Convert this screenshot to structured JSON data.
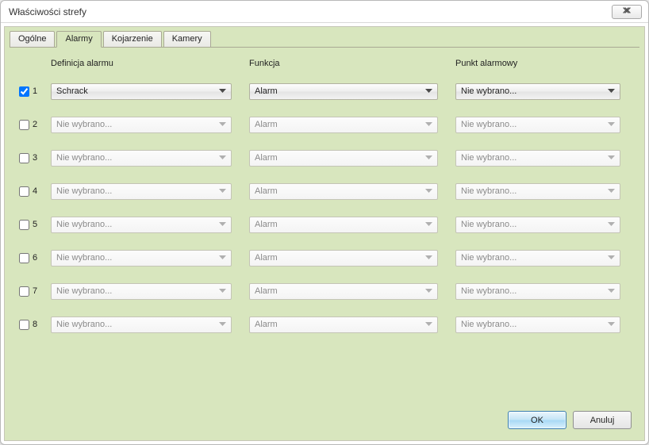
{
  "window": {
    "title": "Właściwości strefy"
  },
  "tabs": {
    "items": [
      "Ogólne",
      "Alarmy",
      "Kojarzenie",
      "Kamery"
    ],
    "active_index": 1
  },
  "headers": {
    "definition": "Definicja alarmu",
    "function": "Funkcja",
    "point": "Punkt alarmowy"
  },
  "rows": [
    {
      "num": "1",
      "checked": true,
      "enabled": true,
      "definition": "Schrack",
      "function": "Alarm",
      "point": "Nie wybrano..."
    },
    {
      "num": "2",
      "checked": false,
      "enabled": false,
      "definition": "Nie wybrano...",
      "function": "Alarm",
      "point": "Nie wybrano..."
    },
    {
      "num": "3",
      "checked": false,
      "enabled": false,
      "definition": "Nie wybrano...",
      "function": "Alarm",
      "point": "Nie wybrano..."
    },
    {
      "num": "4",
      "checked": false,
      "enabled": false,
      "definition": "Nie wybrano...",
      "function": "Alarm",
      "point": "Nie wybrano..."
    },
    {
      "num": "5",
      "checked": false,
      "enabled": false,
      "definition": "Nie wybrano...",
      "function": "Alarm",
      "point": "Nie wybrano..."
    },
    {
      "num": "6",
      "checked": false,
      "enabled": false,
      "definition": "Nie wybrano...",
      "function": "Alarm",
      "point": "Nie wybrano..."
    },
    {
      "num": "7",
      "checked": false,
      "enabled": false,
      "definition": "Nie wybrano...",
      "function": "Alarm",
      "point": "Nie wybrano..."
    },
    {
      "num": "8",
      "checked": false,
      "enabled": false,
      "definition": "Nie wybrano...",
      "function": "Alarm",
      "point": "Nie wybrano..."
    }
  ],
  "buttons": {
    "ok": "OK",
    "cancel": "Anuluj"
  }
}
